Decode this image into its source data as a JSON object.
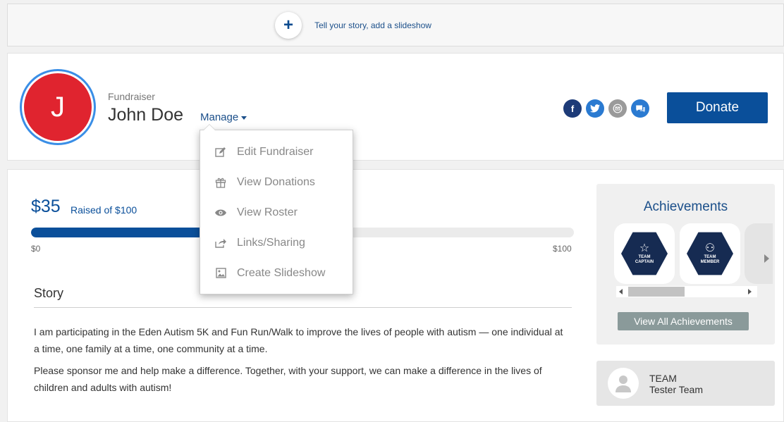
{
  "banner": {
    "link_text": "Tell your story, add a slideshow"
  },
  "header": {
    "avatar_initial": "J",
    "role": "Fundraiser",
    "name": "John Doe",
    "manage_label": "Manage",
    "social_icons": [
      "facebook-icon",
      "twitter-icon",
      "email-icon",
      "chat-icon"
    ],
    "donate_label": "Donate"
  },
  "manage_menu": {
    "items": [
      {
        "label": "Edit Fundraiser",
        "icon": "pencil-square-icon"
      },
      {
        "label": "View Donations",
        "icon": "gift-icon"
      },
      {
        "label": "View Roster",
        "icon": "eye-icon"
      },
      {
        "label": "Links/Sharing",
        "icon": "share-icon"
      },
      {
        "label": "Create Slideshow",
        "icon": "image-icon"
      }
    ]
  },
  "progress": {
    "raised": "$35",
    "raised_of": "Raised of $100",
    "min_label": "$0",
    "max_label": "$100",
    "fraction": 0.35
  },
  "story": {
    "title": "Story",
    "paragraphs": [
      "I am participating in the Eden Autism 5K and Fun Run/Walk to improve the lives of people with autism — one individual at a time, one family at a time, one community at a time.",
      "Please sponsor me and help make a difference. Together, with your support, we can make a difference in the lives of children and adults with autism!"
    ]
  },
  "achievements": {
    "title": "Achievements",
    "badges": [
      {
        "line1": "TEAM",
        "line2": "CAPTAIN"
      },
      {
        "line1": "TEAM",
        "line2": "MEMBER"
      }
    ],
    "view_all_label": "View All Achievements"
  },
  "team": {
    "label": "TEAM",
    "name": "Tester Team"
  },
  "colors": {
    "brand_blue": "#0a4f9a",
    "avatar_red": "#e0242f",
    "link_blue": "#1b4f8a"
  }
}
